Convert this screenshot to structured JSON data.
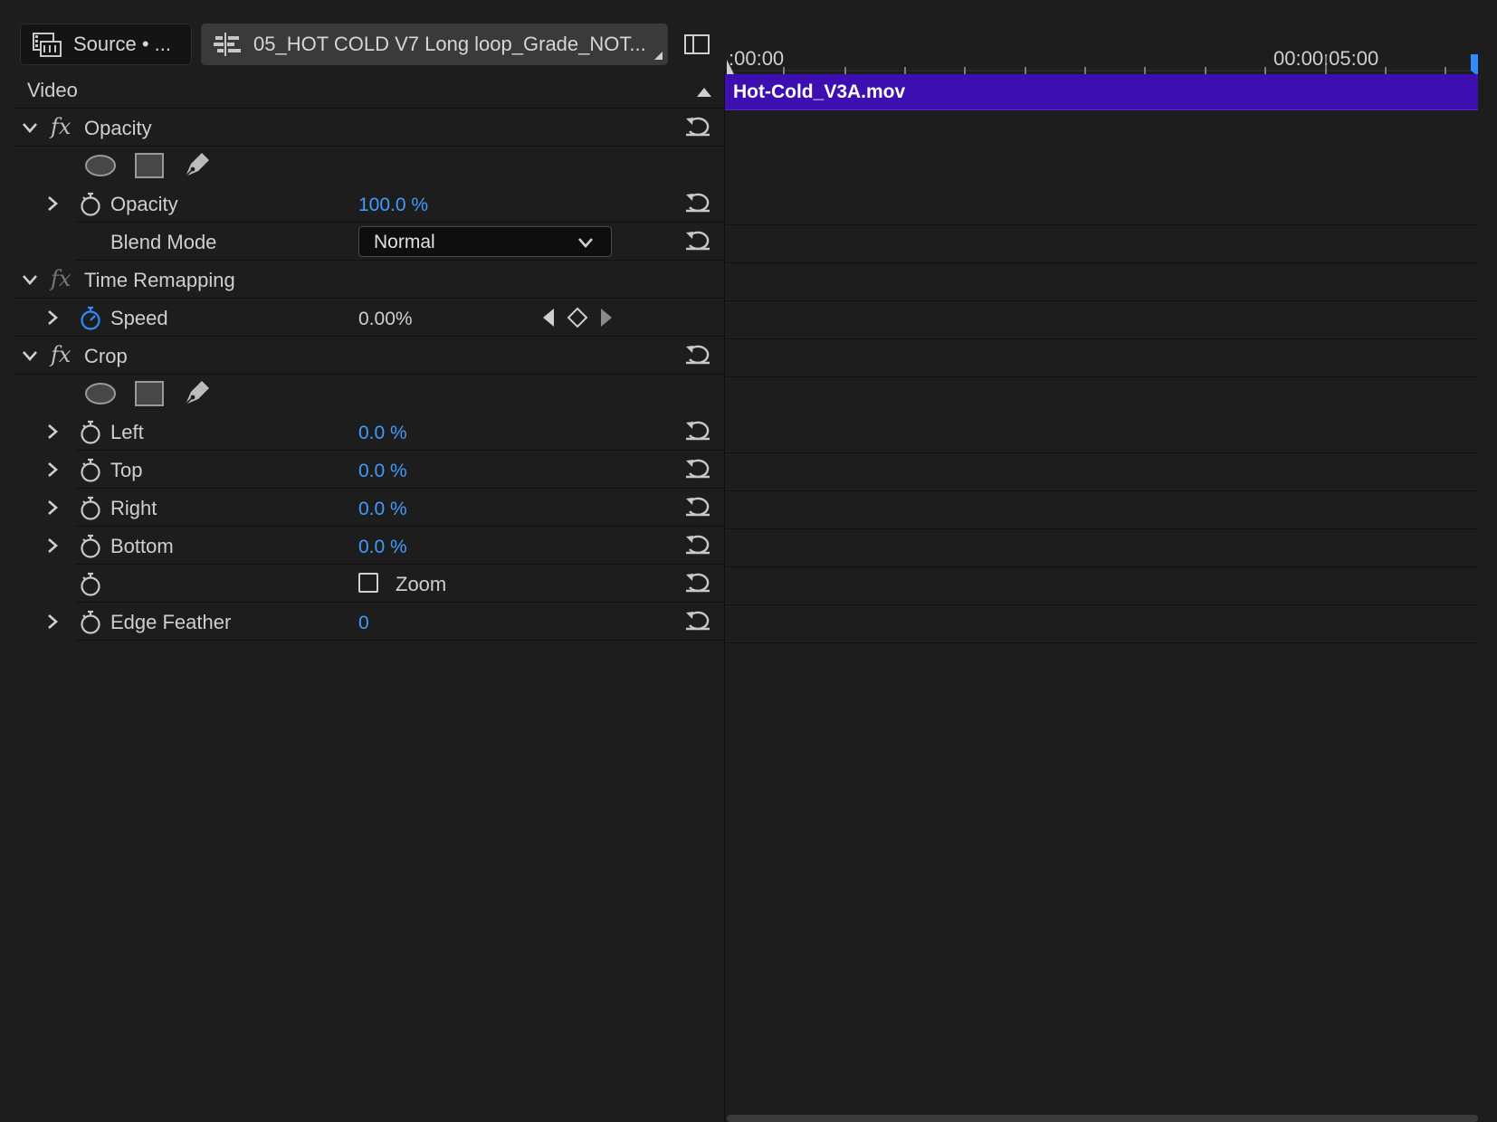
{
  "tabs": {
    "source": "Source • ...",
    "sequence": "05_HOT COLD V7 Long loop_Grade_NOT..."
  },
  "panel": {
    "section": "Video"
  },
  "opacity_fx": {
    "name": "Opacity",
    "opacity_label": "Opacity",
    "opacity_value": "100.0 %",
    "blend_label": "Blend Mode",
    "blend_value": "Normal"
  },
  "time_remap_fx": {
    "name": "Time Remapping",
    "speed_label": "Speed",
    "speed_value": "0.00%"
  },
  "crop_fx": {
    "name": "Crop",
    "left_label": "Left",
    "left_value": "0.0 %",
    "top_label": "Top",
    "top_value": "0.0 %",
    "right_label": "Right",
    "right_value": "0.0 %",
    "bottom_label": "Bottom",
    "bottom_value": "0.0 %",
    "zoom_label": "Zoom",
    "edge_label": "Edge Feather",
    "edge_value": "0"
  },
  "timeline": {
    "start_time": ":00:00",
    "mark_time": "00:00:05:00",
    "clip_name": "Hot-Cold_V3A.mov"
  },
  "colors": {
    "value_blue": "#3f9bff",
    "clip_purple": "#3d0fb0",
    "playhead_blue": "#2f8cff"
  },
  "icons": {
    "source_tab": "film-strip-icon",
    "sequence_tab": "sequence-icon",
    "reset": "reset-icon",
    "stopwatch": "stopwatch-icon",
    "mask_ellipse": "ellipse-mask-icon",
    "mask_rect": "rectangle-mask-icon",
    "mask_pen": "pen-mask-icon"
  }
}
